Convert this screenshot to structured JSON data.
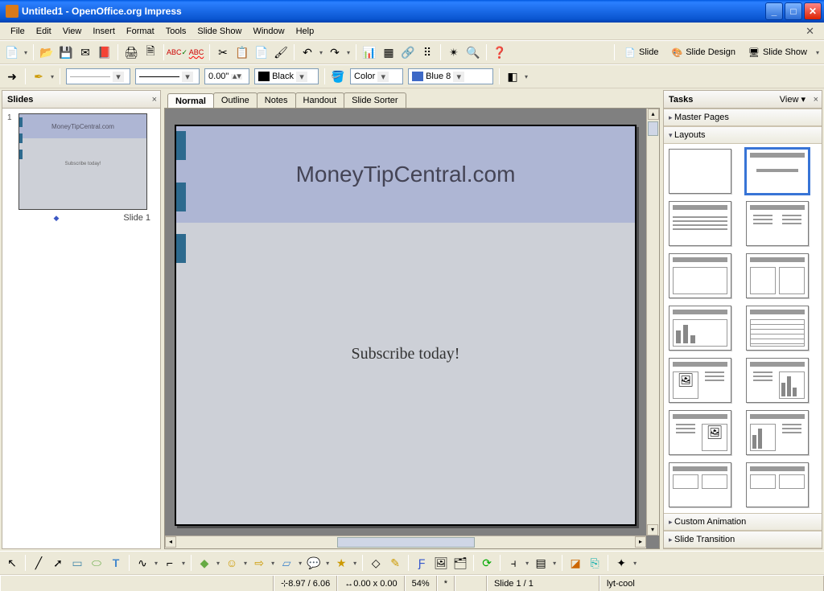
{
  "window": {
    "title": "Untitled1 - OpenOffice.org Impress"
  },
  "menu": [
    "File",
    "Edit",
    "View",
    "Insert",
    "Format",
    "Tools",
    "Slide Show",
    "Window",
    "Help"
  ],
  "formatting": {
    "line_width": "0.00\"",
    "line_color": "Black",
    "fill_type": "Color",
    "fill_color_name": "Blue 8",
    "fill_color_hex": "#3e69c6"
  },
  "toolbar_right": {
    "slide": "Slide",
    "slide_design": "Slide Design",
    "slide_show": "Slide Show"
  },
  "slides_panel": {
    "title": "Slides",
    "slide_number": "1",
    "slide_label": "Slide 1"
  },
  "slide_content": {
    "title": "MoneyTipCentral.com",
    "body": "Subscribe today!"
  },
  "view_tabs": [
    "Normal",
    "Outline",
    "Notes",
    "Handout",
    "Slide Sorter"
  ],
  "active_view_tab": "Normal",
  "tasks_panel": {
    "title": "Tasks",
    "view_label": "View",
    "sections": {
      "master_pages": "Master Pages",
      "layouts": "Layouts",
      "custom_animation": "Custom Animation",
      "slide_transition": "Slide Transition"
    }
  },
  "status": {
    "cursor": "8.97 / 6.06",
    "dims": "0.00 x 0.00",
    "zoom": "54%",
    "modified": "*",
    "page": "Slide 1 / 1",
    "template": "lyt-cool"
  }
}
